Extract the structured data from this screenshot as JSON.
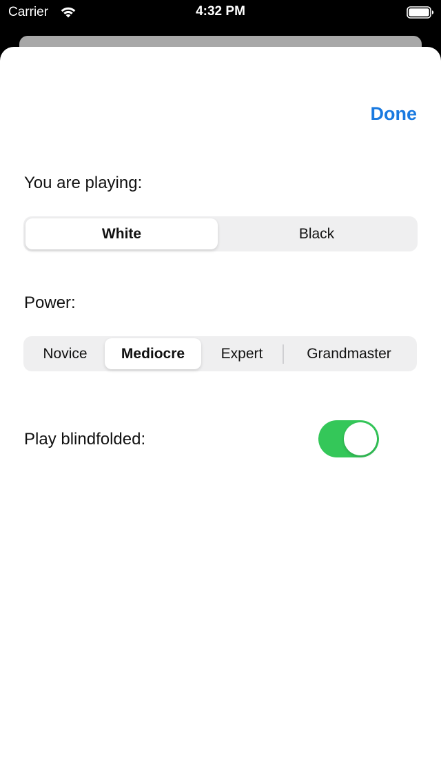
{
  "status_bar": {
    "carrier": "Carrier",
    "time": "4:32 PM",
    "wifi_icon": "wifi-icon",
    "battery_icon": "battery-full-icon"
  },
  "header": {
    "done_label": "Done"
  },
  "color_section": {
    "label": "You are playing:",
    "options": [
      "White",
      "Black"
    ],
    "selected": "White"
  },
  "power_section": {
    "label": "Power:",
    "options": [
      "Novice",
      "Mediocre",
      "Expert",
      "Grandmaster"
    ],
    "selected": "Mediocre"
  },
  "blindfold_section": {
    "label": "Play blindfolded:",
    "enabled": true
  },
  "colors": {
    "accent": "#1a7ae0",
    "toggle_on": "#34c759",
    "segment_bg": "#efeff0"
  }
}
